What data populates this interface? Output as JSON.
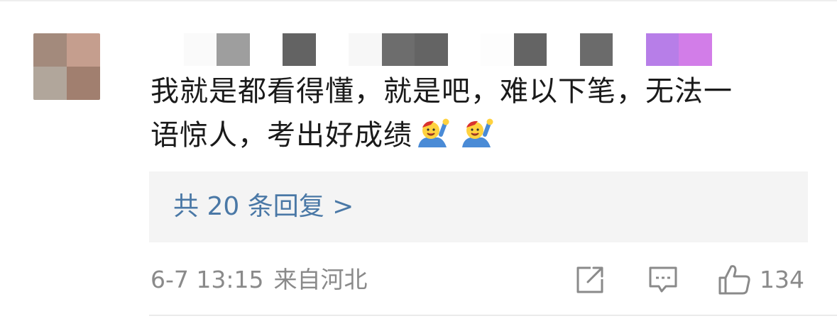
{
  "comment": {
    "text_line1": "我就是都看得懂，就是吧，难以下笔，无法一",
    "text_line2": "语惊人，考出好成绩",
    "emojis": [
      "cheering-person-emoji",
      "cheering-person-emoji"
    ]
  },
  "replies": {
    "label": "共 20 条回复 >"
  },
  "meta": {
    "date": "6-7 13:15",
    "location": "来自河北"
  },
  "actions": {
    "like_count": "134",
    "share_icon": "share-icon",
    "comment_icon": "comment-icon",
    "like_icon": "thumbs-up-icon"
  },
  "colors": {
    "reply_link": "#4a78a6",
    "meta_text": "#8a8a8a",
    "body_text": "#1a1a1a",
    "reply_bg": "#f4f4f4"
  },
  "avatar_mosaic": {
    "colors": [
      "#a38a7c",
      "#c59e8e",
      "#b1a69b",
      "#a17f6f"
    ]
  },
  "username_mosaic": {
    "colors": [
      "#ffffff",
      "#fafafa",
      "#9e9e9e",
      "#ffffff",
      "#636363",
      "#ffffff",
      "#f7f7f7",
      "#6d6d6d",
      "#646464",
      "#ffffff",
      "#fdfdfd",
      "#646464",
      "#ffffff",
      "#6b6b6b",
      "#ffffff",
      "#b77ee8",
      "#d27de8"
    ]
  }
}
